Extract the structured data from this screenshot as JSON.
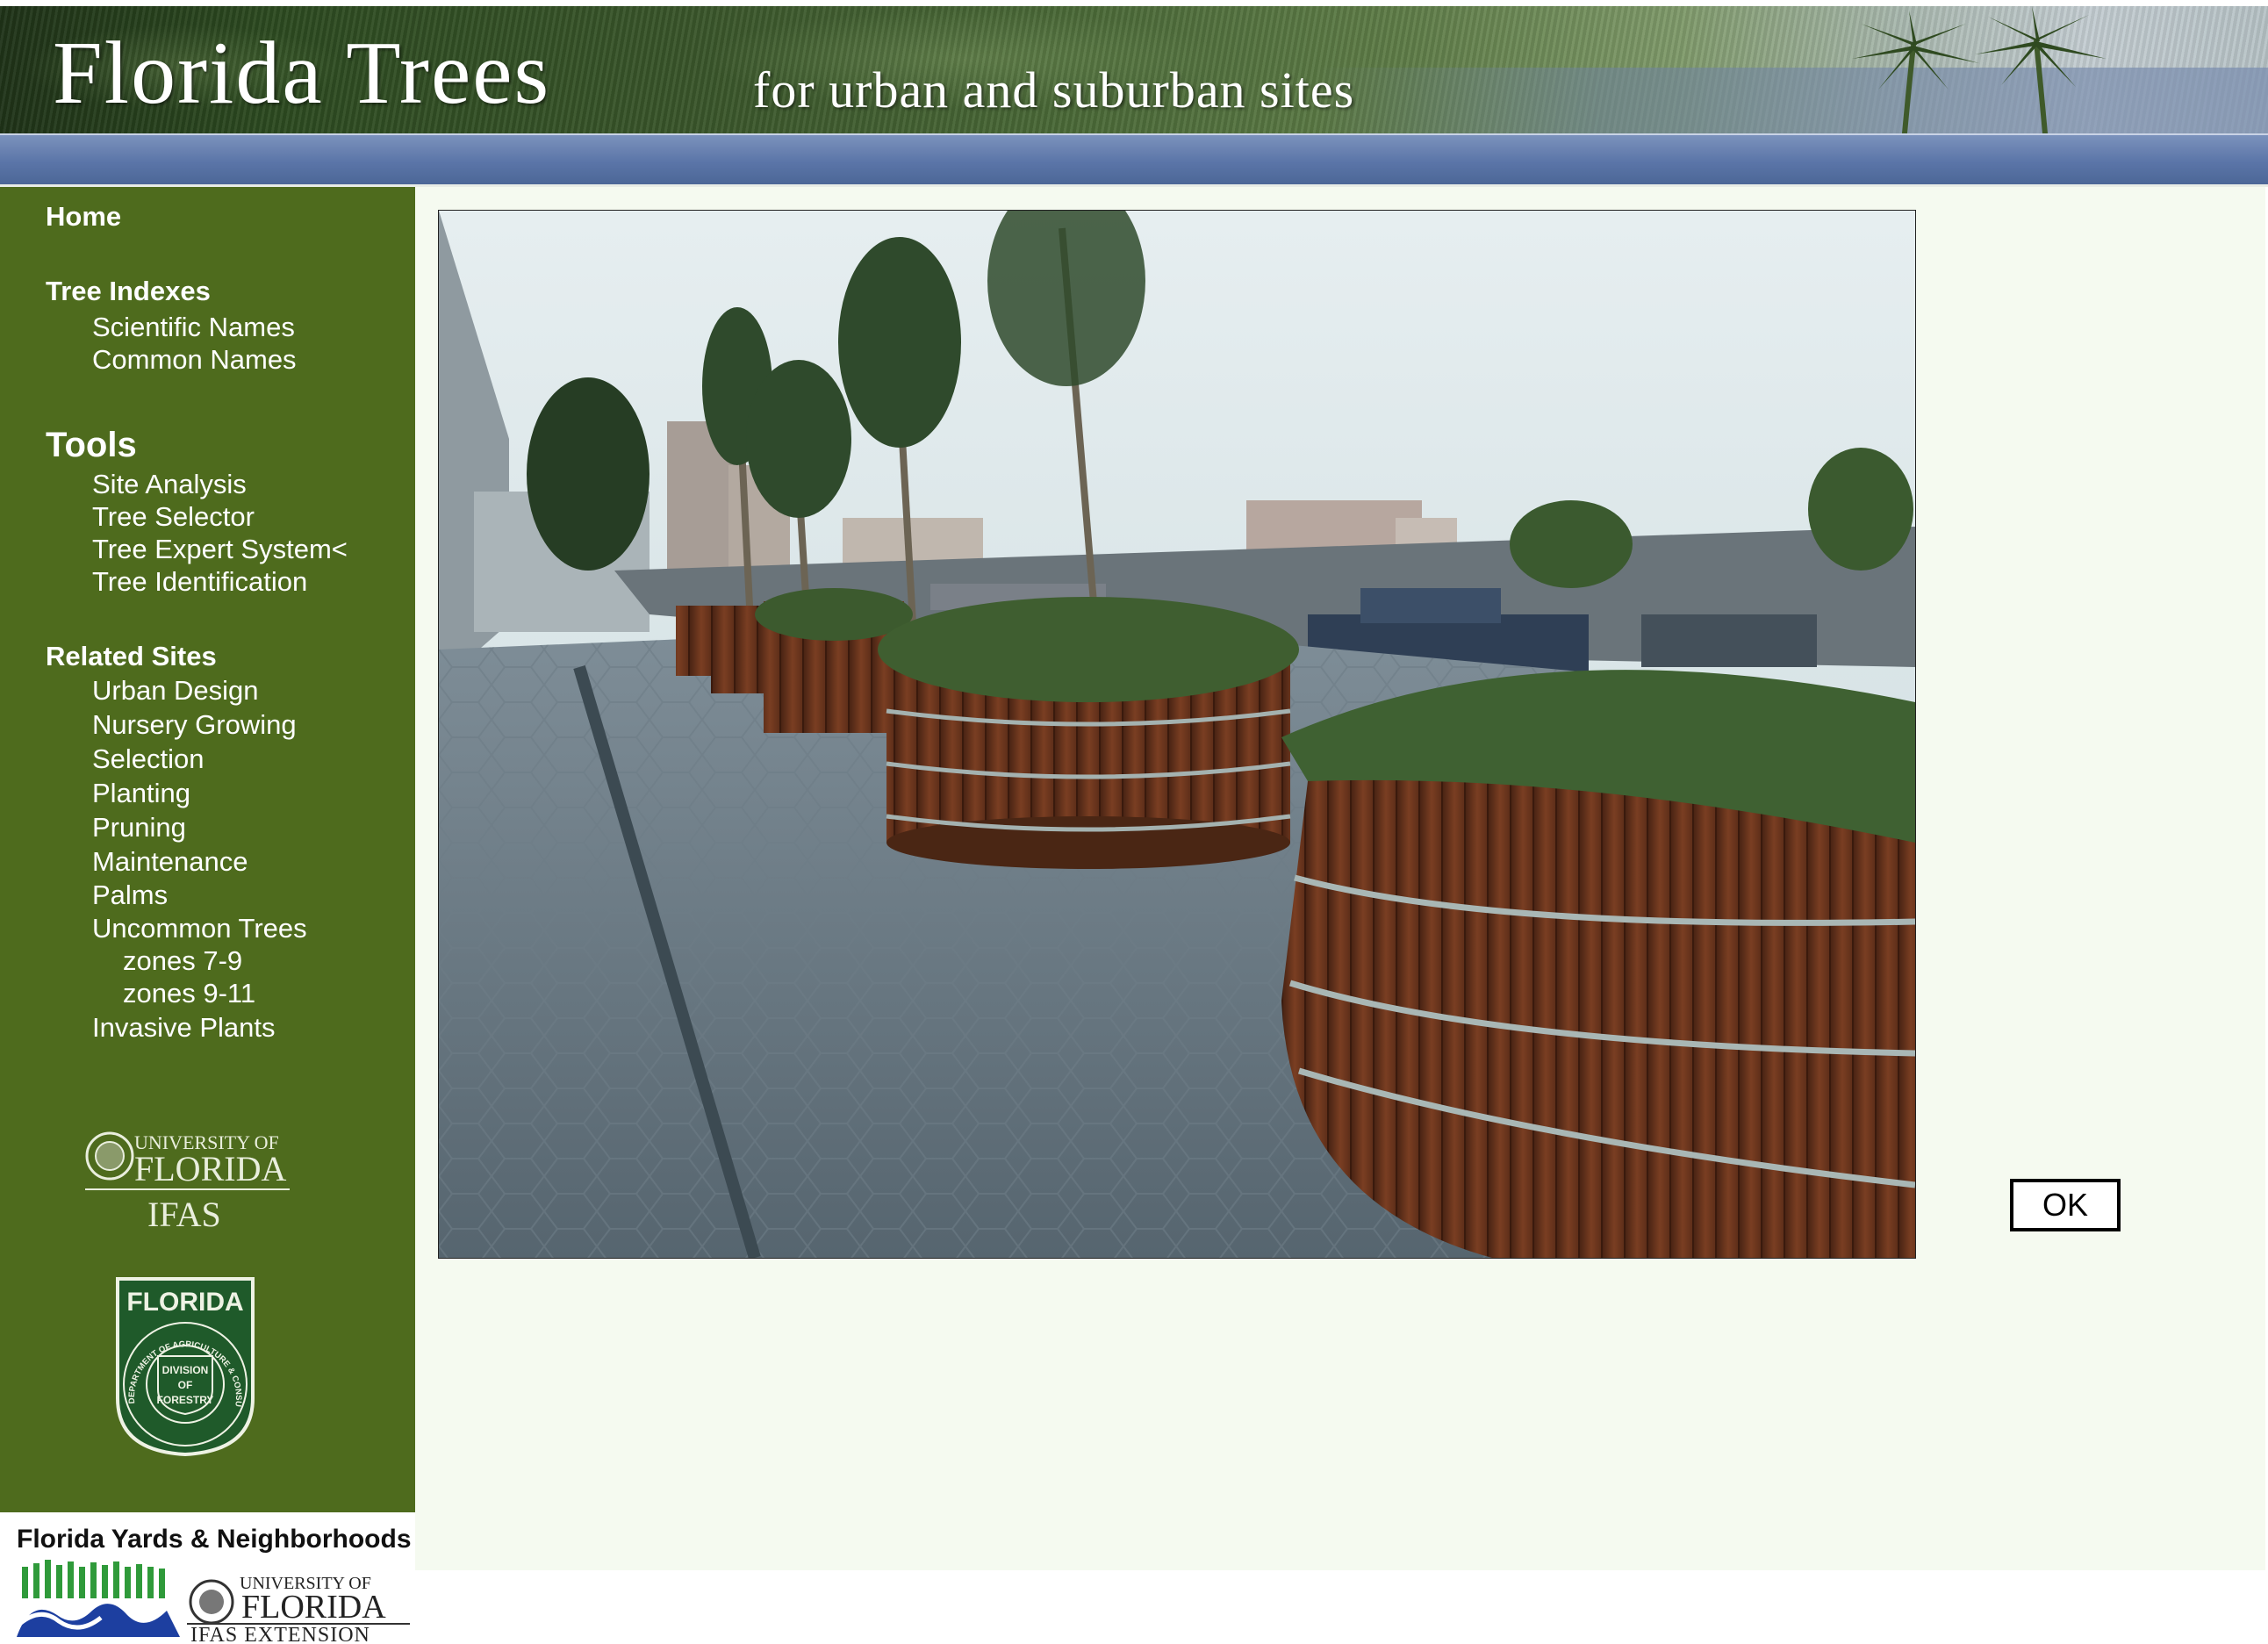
{
  "banner": {
    "title": "Florida Trees",
    "subtitle": "for urban and suburban sites"
  },
  "sidebar": {
    "home": "Home",
    "tree_indexes": {
      "heading": "Tree Indexes",
      "items": [
        "Scientific Names",
        "Common Names"
      ]
    },
    "tools": {
      "heading": "Tools",
      "items": [
        "Site Analysis",
        "Tree Selector",
        "Tree Expert System<",
        "Tree Identification"
      ]
    },
    "related_sites": {
      "heading": "Related Sites",
      "items": [
        "Urban Design",
        "Nursery Growing",
        "Selection",
        "Planting",
        "Pruning",
        "Maintenance",
        "Palms",
        "Uncommon Trees"
      ],
      "uncommon_sub": [
        "zones 7-9",
        "zones 9-11"
      ],
      "last": "Invasive Plants"
    },
    "logos": {
      "uf": {
        "line1": "UNIVERSITY OF",
        "line2": "FLORIDA",
        "line3": "IFAS"
      },
      "fdacs": {
        "top": "FLORIDA",
        "center": [
          "DIVISION",
          "OF",
          "FORESTRY"
        ],
        "ring": "DEPARTMENT OF AGRICULTURE & CONSUMER SERVICES"
      },
      "fyn": {
        "title": "Florida Yards & Neighborhoods",
        "uf1": "UNIVERSITY OF",
        "uf2": "FLORIDA",
        "ext": "IFAS EXTENSION"
      }
    }
  },
  "main": {
    "photo_alt": "photo",
    "ok_label": "OK"
  },
  "colors": {
    "sidebar": "#4e6b1d",
    "main_bg": "#f5faf0",
    "band": "#5b75a8"
  }
}
